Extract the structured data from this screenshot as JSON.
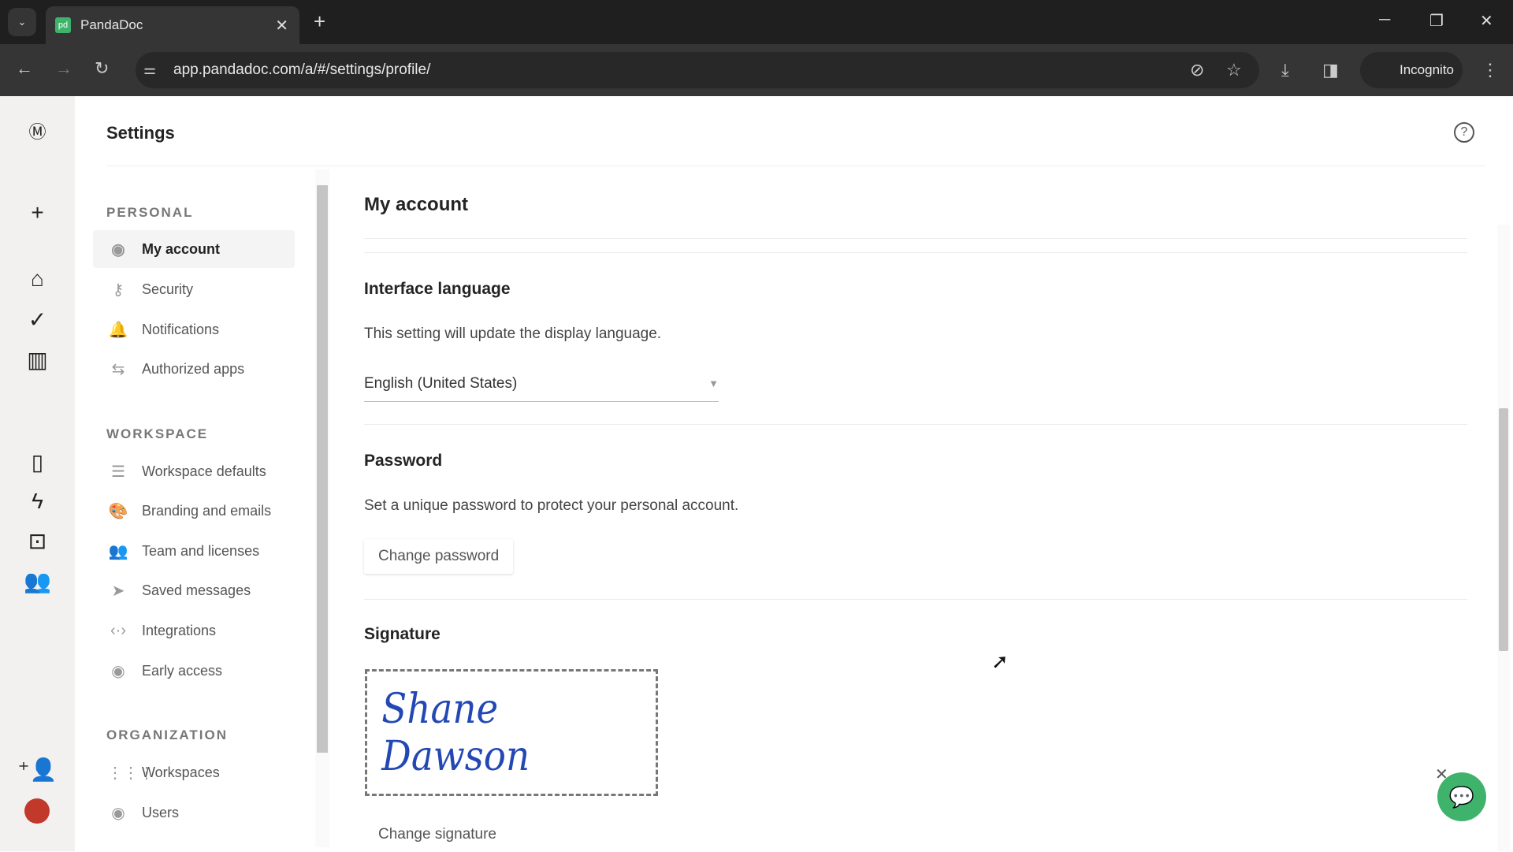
{
  "browser": {
    "tab_title": "PandaDoc",
    "url": "app.pandadoc.com/a/#/settings/profile/",
    "incognito_label": "Incognito"
  },
  "page": {
    "title": "Settings"
  },
  "sidebar": {
    "sections": [
      {
        "label": "PERSONAL",
        "items": [
          {
            "label": "My account",
            "icon": "user-circle-icon",
            "active": true
          },
          {
            "label": "Security",
            "icon": "key-icon"
          },
          {
            "label": "Notifications",
            "icon": "bell-icon"
          },
          {
            "label": "Authorized apps",
            "icon": "arrows-swap-icon"
          }
        ]
      },
      {
        "label": "WORKSPACE",
        "items": [
          {
            "label": "Workspace defaults",
            "icon": "sliders-icon"
          },
          {
            "label": "Branding and emails",
            "icon": "palette-icon"
          },
          {
            "label": "Team and licenses",
            "icon": "team-icon"
          },
          {
            "label": "Saved messages",
            "icon": "send-icon"
          },
          {
            "label": "Integrations",
            "icon": "code-icon"
          },
          {
            "label": "Early access",
            "icon": "eye-icon"
          }
        ]
      },
      {
        "label": "ORGANIZATION",
        "items": [
          {
            "label": "Workspaces",
            "icon": "grid-icon"
          },
          {
            "label": "Users",
            "icon": "user-circle-icon"
          }
        ]
      }
    ]
  },
  "main": {
    "title": "My account",
    "language": {
      "heading": "Interface language",
      "description": "This setting will update the display language.",
      "selected": "English (United States)"
    },
    "password": {
      "heading": "Password",
      "description": "Set a unique password to protect your personal account.",
      "button": "Change password"
    },
    "signature": {
      "heading": "Signature",
      "signature_text": "Shane Dawson",
      "button": "Change signature"
    }
  },
  "colors": {
    "brand": "#3fb36b",
    "signature": "#2348b5"
  }
}
